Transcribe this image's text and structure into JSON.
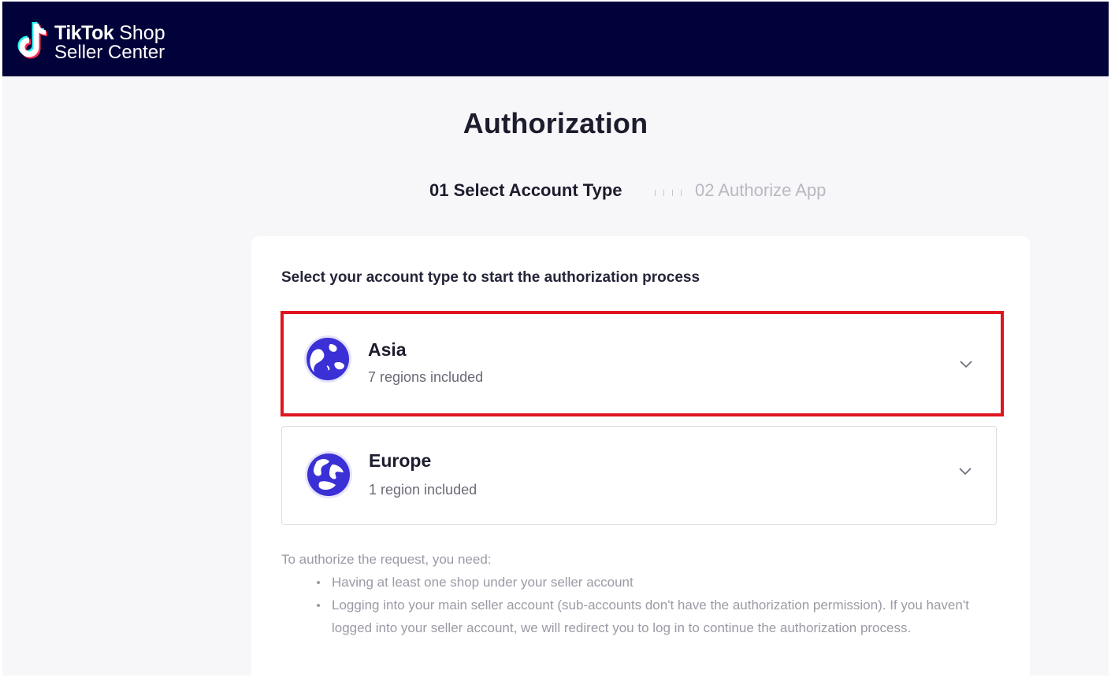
{
  "header": {
    "logo_brand": "TikTok",
    "logo_product": "Shop",
    "logo_subtitle": "Seller Center"
  },
  "page_title": "Authorization",
  "steps": [
    {
      "label": "01 Select Account Type",
      "state": "active"
    },
    {
      "label": "02 Authorize App",
      "state": "inactive"
    }
  ],
  "prompt": "Select your account type to start the authorization process",
  "options": [
    {
      "name": "Asia",
      "sub": "7 regions included",
      "icon": "globe-icon",
      "selected": true
    },
    {
      "name": "Europe",
      "sub": "1 region included",
      "icon": "globe-icon",
      "selected": false
    }
  ],
  "notes": {
    "intro": "To authorize the request, you need:",
    "items": [
      "Having at least one shop under your seller account",
      "Logging into your main seller account (sub-accounts don't have the authorization permission). If you haven't logged into your seller account, we will redirect you to log in to continue the authorization process."
    ]
  },
  "colors": {
    "header_bg": "#02023a",
    "accent_globe": "#3b30d6",
    "highlight_border": "#e0141e",
    "page_bg": "#f7f7f9"
  }
}
